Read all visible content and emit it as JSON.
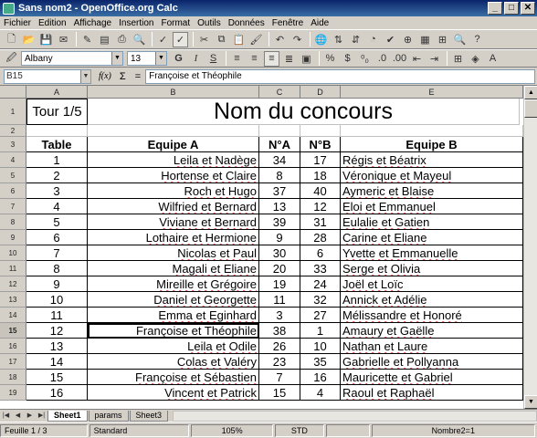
{
  "window": {
    "title": "Sans nom2 - OpenOffice.org Calc",
    "min_label": "_",
    "max_label": "□",
    "close_label": "✕"
  },
  "menu": [
    "Fichier",
    "Edition",
    "Affichage",
    "Insertion",
    "Format",
    "Outils",
    "Données",
    "Fenêtre",
    "Aide"
  ],
  "formatting": {
    "font_name": "Albany",
    "font_size": "13",
    "bold_glyph": "G",
    "italic_glyph": "I",
    "underline_glyph": "S"
  },
  "formula_bar": {
    "cell_ref": "B15",
    "fx_label": "f(x)",
    "sum_label": "Σ",
    "equals_label": "=",
    "content": "Françoise et Théophile"
  },
  "columns": [
    "A",
    "B",
    "C",
    "D",
    "E"
  ],
  "rows": [
    "1",
    "2",
    "3",
    "4",
    "5",
    "6",
    "7",
    "8",
    "9",
    "10",
    "11",
    "12",
    "13",
    "14",
    "15",
    "16",
    "17",
    "18",
    "19"
  ],
  "selected_row": "15",
  "sheet": {
    "tour_label": "Tour 1/5",
    "title": "Nom du concours",
    "headers": {
      "table": "Table",
      "equipe_a": "Equipe A",
      "na": "N°A",
      "nb": "N°B",
      "equipe_b": "Equipe B"
    },
    "data": [
      {
        "table": "1",
        "equipe_a": "Leila et Nadège",
        "na": "34",
        "nb": "17",
        "equipe_b": "Régis et Béatrix"
      },
      {
        "table": "2",
        "equipe_a": "Hortense et Claire",
        "na": "8",
        "nb": "18",
        "equipe_b": "Véronique et Mayeul"
      },
      {
        "table": "3",
        "equipe_a": "Roch et Hugo",
        "na": "37",
        "nb": "40",
        "equipe_b": "Aymeric et Blaise"
      },
      {
        "table": "4",
        "equipe_a": "Wilfried et Bernard",
        "na": "13",
        "nb": "12",
        "equipe_b": "Eloi et Emmanuel"
      },
      {
        "table": "5",
        "equipe_a": "Viviane et Bernard",
        "na": "39",
        "nb": "31",
        "equipe_b": "Eulalie et Gatien"
      },
      {
        "table": "6",
        "equipe_a": "Lothaire et Hermione",
        "na": "9",
        "nb": "28",
        "equipe_b": "Carine et Eliane"
      },
      {
        "table": "7",
        "equipe_a": "Nicolas et Paul",
        "na": "30",
        "nb": "6",
        "equipe_b": "Yvette et Emmanuelle"
      },
      {
        "table": "8",
        "equipe_a": "Magali et Eliane",
        "na": "20",
        "nb": "33",
        "equipe_b": "Serge et Olivia"
      },
      {
        "table": "9",
        "equipe_a": "Mireille et Grégoire",
        "na": "19",
        "nb": "24",
        "equipe_b": "Joël et Loïc"
      },
      {
        "table": "10",
        "equipe_a": "Daniel et Georgette",
        "na": "11",
        "nb": "32",
        "equipe_b": "Annick et Adélie"
      },
      {
        "table": "11",
        "equipe_a": "Emma et Eginhard",
        "na": "3",
        "nb": "27",
        "equipe_b": "Mélissandre et Honoré"
      },
      {
        "table": "12",
        "equipe_a": "Françoise et Théophile",
        "na": "38",
        "nb": "1",
        "equipe_b": "Amaury et Gaëlle"
      },
      {
        "table": "13",
        "equipe_a": "Leila et Odile",
        "na": "26",
        "nb": "10",
        "equipe_b": "Nathan et Laure"
      },
      {
        "table": "14",
        "equipe_a": "Colas et Valéry",
        "na": "23",
        "nb": "35",
        "equipe_b": "Gabrielle et Pollyanna"
      },
      {
        "table": "15",
        "equipe_a": "Françoise et Sébastien",
        "na": "7",
        "nb": "16",
        "equipe_b": "Mauricette et Gabriel"
      },
      {
        "table": "16",
        "equipe_a": "Vincent et Patrick",
        "na": "15",
        "nb": "4",
        "equipe_b": "Raoul et Raphaël"
      }
    ]
  },
  "tabs": [
    "Sheet1",
    "params",
    "Sheet3"
  ],
  "active_tab": "Sheet1",
  "status": {
    "sheet": "Feuille 1 / 3",
    "style": "Standard",
    "zoom": "105%",
    "mode": "STD",
    "sum": "Nombre2=1"
  }
}
